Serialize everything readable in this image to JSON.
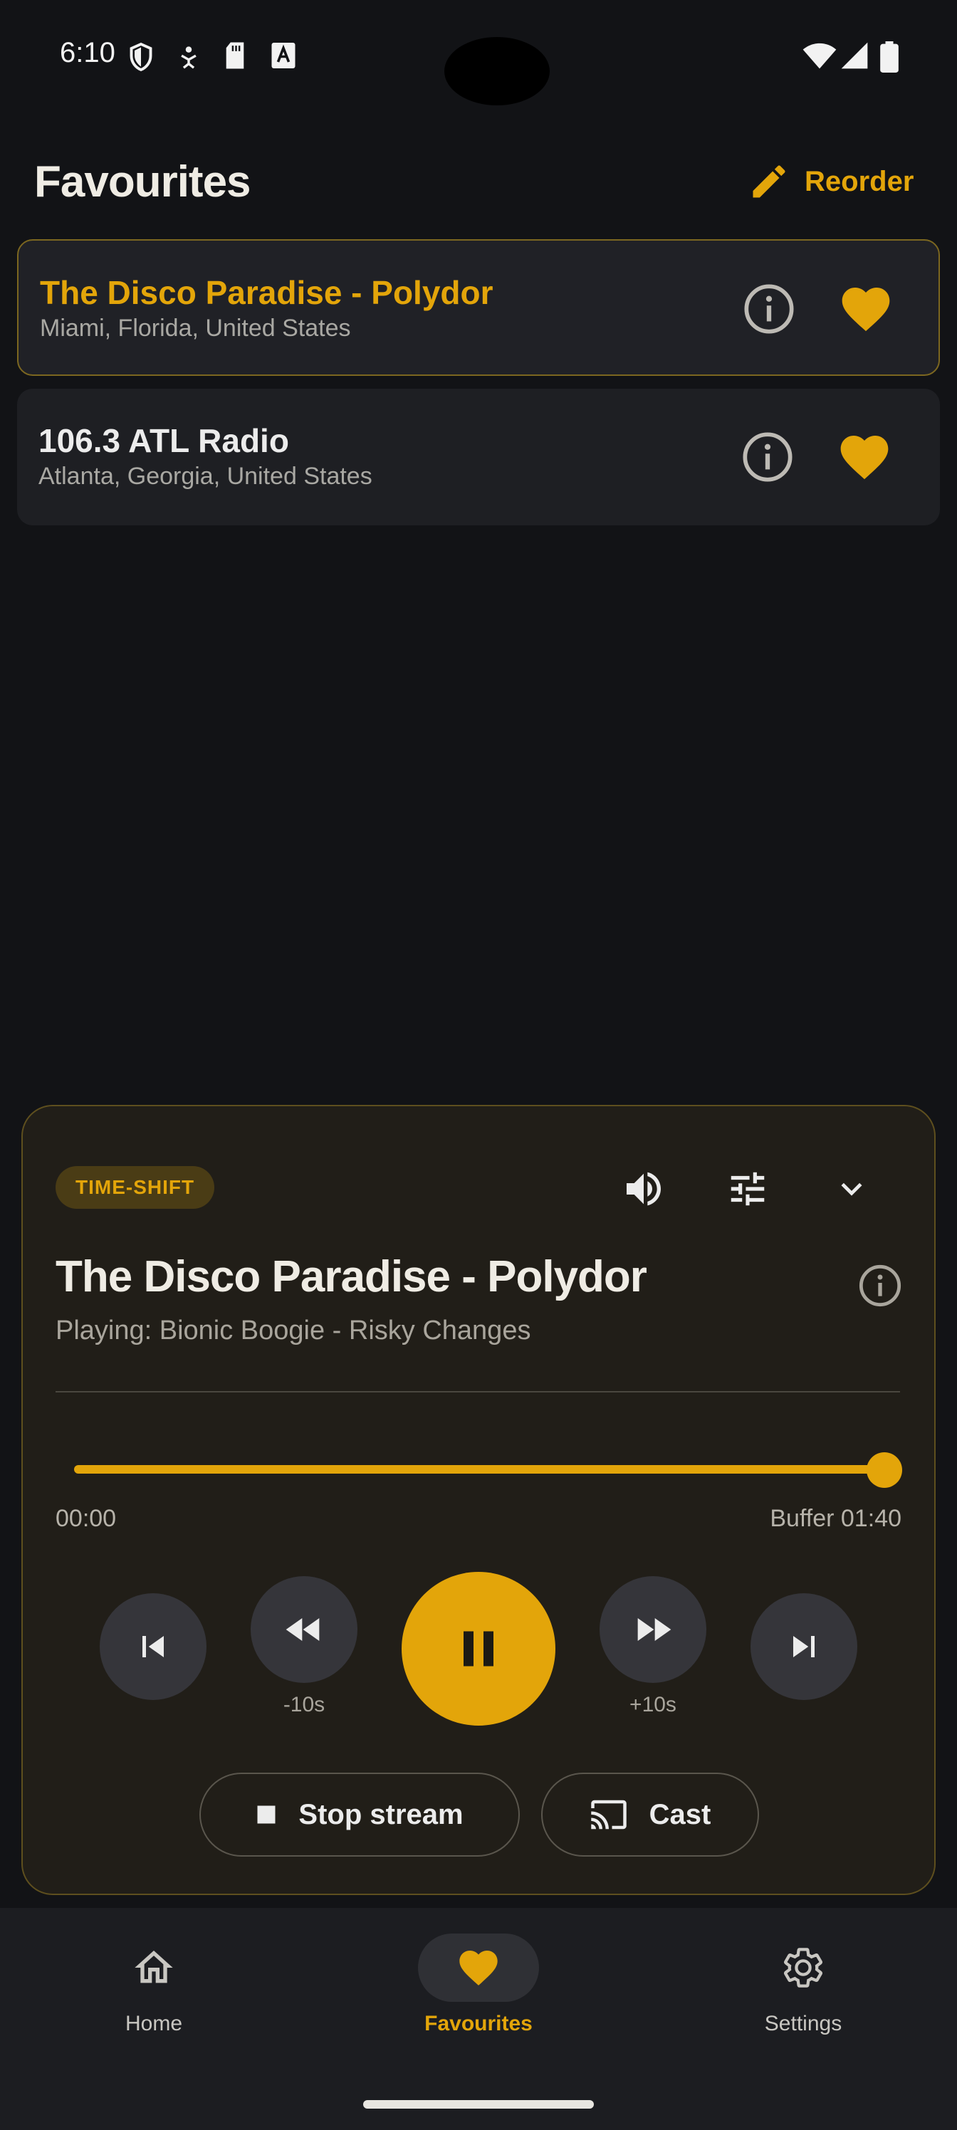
{
  "status_bar": {
    "time": "6:10",
    "icons": [
      "shield-icon",
      "accessibility-icon",
      "sd-card-icon",
      "a-badge-icon",
      "wifi-icon",
      "signal-icon",
      "battery-icon"
    ]
  },
  "header": {
    "title": "Favourites",
    "reorder_label": "Reorder"
  },
  "stations": [
    {
      "name": "The Disco Paradise - Polydor",
      "location": "Miami, Florida, United States",
      "active": true
    },
    {
      "name": "106.3 ATL Radio",
      "location": "Atlanta, Georgia, United States",
      "active": false
    }
  ],
  "player": {
    "badge": "TIME-SHIFT",
    "title": "The Disco Paradise - Polydor",
    "now_playing": "Playing: Bionic Boogie - Risky Changes",
    "position": "00:00",
    "buffer": "Buffer 01:40",
    "progress": 1.0,
    "rewind_label": "-10s",
    "forward_label": "+10s",
    "stop_label": "Stop stream",
    "cast_label": "Cast"
  },
  "nav": {
    "items": [
      {
        "label": "Home",
        "icon": "home-icon",
        "active": false
      },
      {
        "label": "Favourites",
        "icon": "heart-icon",
        "active": true
      },
      {
        "label": "Settings",
        "icon": "gear-icon",
        "active": false
      }
    ]
  },
  "colors": {
    "accent": "#e3a50a",
    "background": "#121316",
    "card": "#1e1f23",
    "player_bg": "#211e18"
  }
}
